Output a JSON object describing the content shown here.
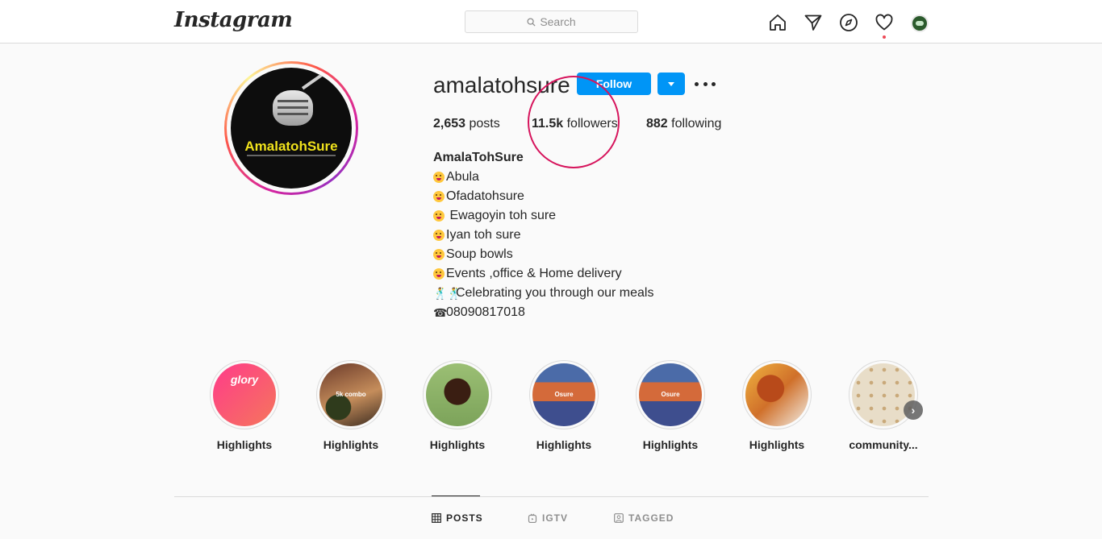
{
  "nav": {
    "logo": "Instagram",
    "search_placeholder": "Search",
    "icons": [
      "home-icon",
      "direct-icon",
      "explore-icon",
      "activity-heart-icon",
      "profile-avatar"
    ]
  },
  "profile": {
    "username": "amalatohsure",
    "avatar_text": "AmalatohSure",
    "follow_label": "Follow",
    "stats": {
      "posts_count": "2,653",
      "posts_label": " posts",
      "followers_count": "11.5k",
      "followers_label": " followers",
      "following_count": "882",
      "following_label": " following"
    },
    "bio": {
      "name": "AmalaTohSure",
      "lines": [
        "Abula",
        "Ofadatohsure",
        " Ewagoyin toh sure",
        "Iyan toh sure",
        "Soup bowls",
        "Events ,office & Home delivery",
        "Celebrating you through our meals",
        "08090817018"
      ]
    }
  },
  "highlights": [
    {
      "label": "Highlights",
      "caption": "glory"
    },
    {
      "label": "Highlights",
      "caption": "5k combo"
    },
    {
      "label": "Highlights",
      "caption": ""
    },
    {
      "label": "Highlights",
      "caption": "Osure"
    },
    {
      "label": "Highlights",
      "caption": "Osure"
    },
    {
      "label": "Highlights",
      "caption": ""
    },
    {
      "label": "community...",
      "caption": ""
    }
  ],
  "tabs": {
    "posts": "POSTS",
    "igtv": "IGTV",
    "tagged": "TAGGED"
  },
  "colors": {
    "follow_button": "#0095f6",
    "annotation_circle": "#d6145c",
    "notification_dot": "#ed4956"
  }
}
